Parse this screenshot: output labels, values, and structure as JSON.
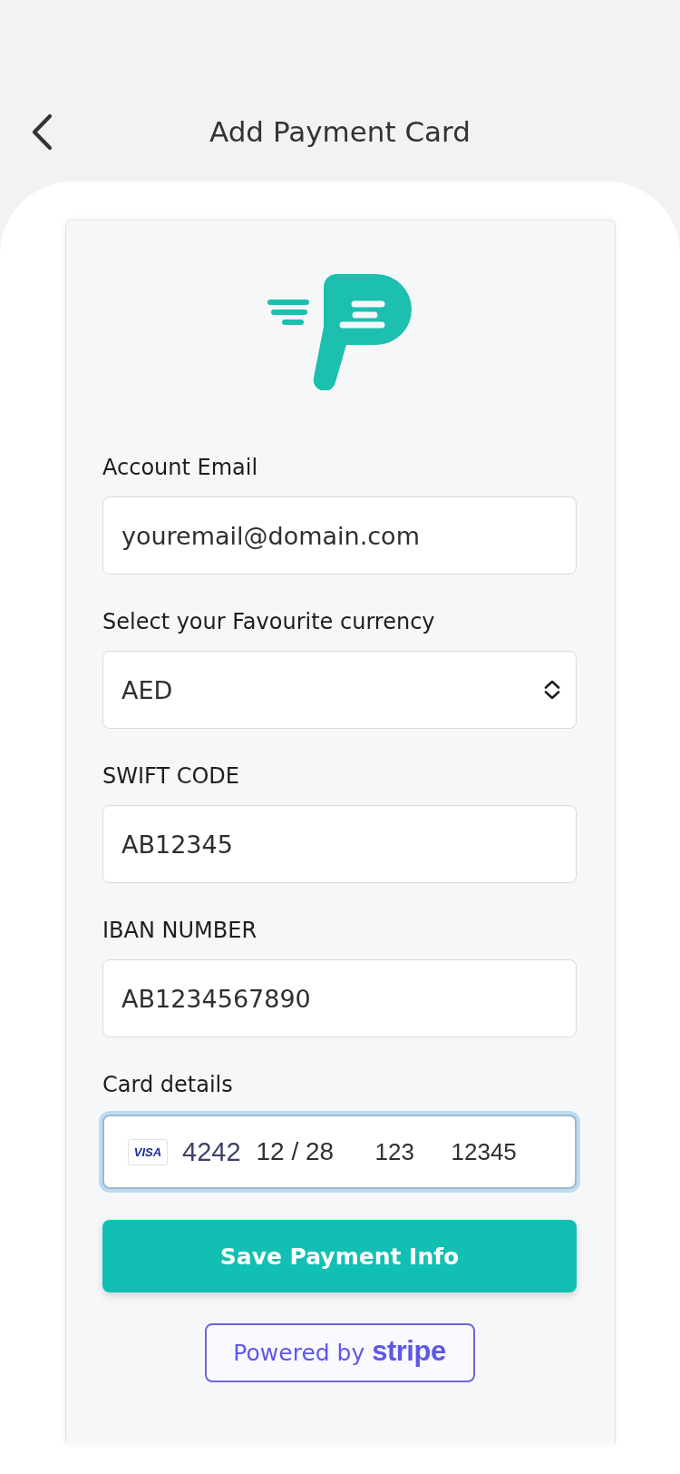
{
  "header": {
    "title": "Add Payment Card"
  },
  "form": {
    "fields": [
      {
        "kind": "text",
        "label": "Account Email",
        "value": "youremail@domain.com"
      },
      {
        "kind": "select",
        "label": "Select your Favourite currency",
        "value": "AED"
      },
      {
        "kind": "text",
        "label": "SWIFT CODE",
        "value": "AB12345"
      },
      {
        "kind": "text",
        "label": "IBAN NUMBER",
        "value": "AB1234567890"
      }
    ],
    "card_details": {
      "label": "Card details",
      "focused": true,
      "brand": "VISA",
      "number": "4242",
      "expiry": "12 / 28",
      "cvc": "123",
      "postal_code": "12345"
    }
  },
  "save_button": {
    "label": "Save Payment Info"
  },
  "stripe_badge": {
    "text": "Powered by **stripe**"
  }
}
